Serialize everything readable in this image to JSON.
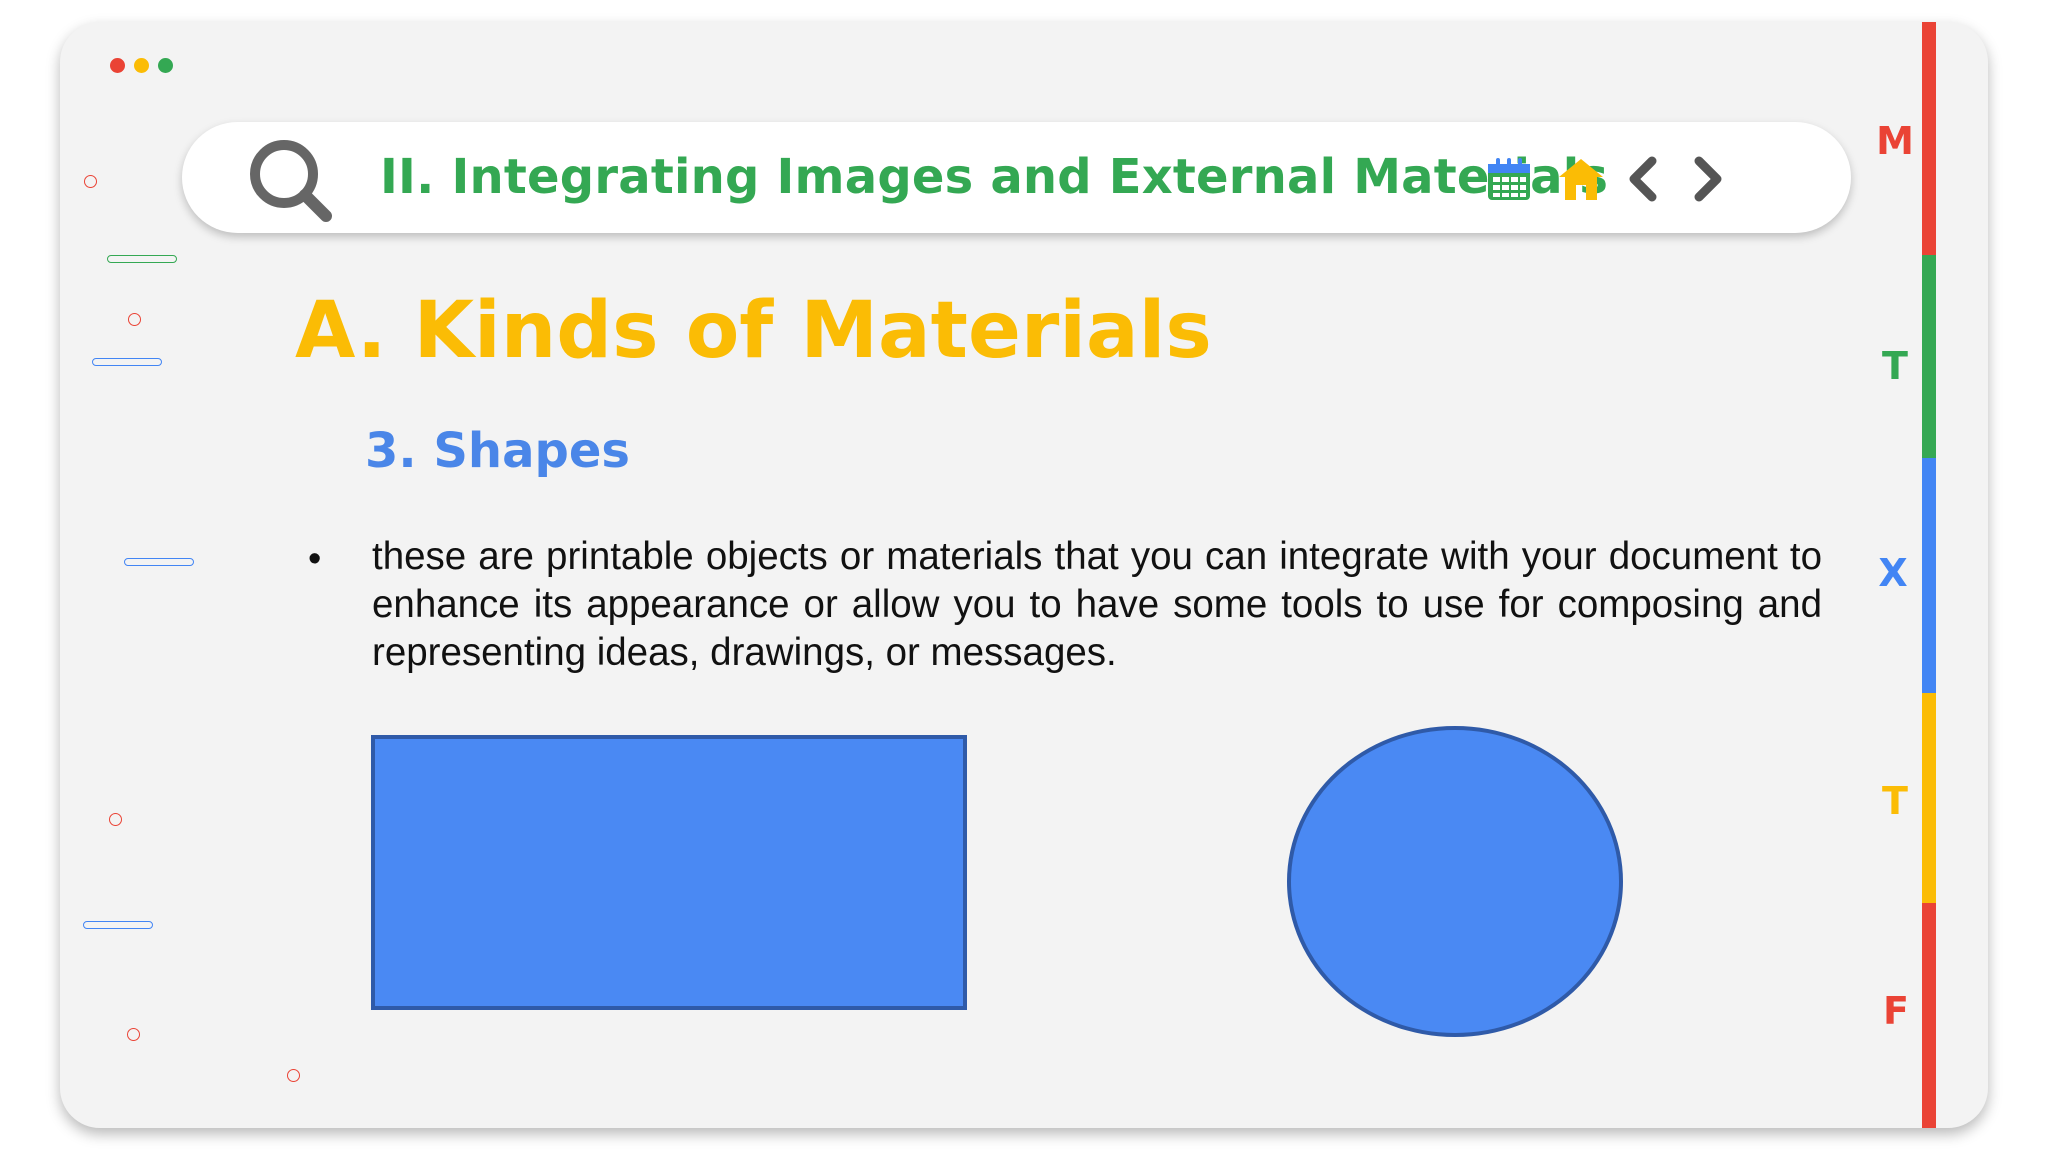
{
  "window": {
    "controls": [
      {
        "name": "close",
        "color": "#ea4335"
      },
      {
        "name": "minimize",
        "color": "#fbbc05"
      },
      {
        "name": "maximize",
        "color": "#34a853"
      }
    ]
  },
  "search_bar": {
    "title": "II. Integrating Images and External Materials",
    "title_color": "#34a853",
    "icons": [
      "search-icon",
      "calendar-icon",
      "home-icon",
      "chevron-left-icon",
      "chevron-right-icon"
    ]
  },
  "content": {
    "heading": "A. Kinds of Materials",
    "subheading": "3. Shapes",
    "bullet_symbol": "•",
    "body": "these are printable objects or materials that you can integrate with your document to enhance its appearance or allow you to have some tools to use for composing and representing ideas, drawings, or messages."
  },
  "shapes": [
    {
      "kind": "rectangle",
      "fill": "#4a89f3",
      "stroke": "#2f5aa8"
    },
    {
      "kind": "ellipse",
      "fill": "#4a89f3",
      "stroke": "#2f5aa8"
    }
  ],
  "side_tabs": [
    {
      "letter": "M",
      "color": "#ea4335"
    },
    {
      "letter": "T",
      "color": "#34a853"
    },
    {
      "letter": "X",
      "color": "#4285f4"
    },
    {
      "letter": "T",
      "color": "#fbbc05"
    },
    {
      "letter": "F",
      "color": "#ea4335"
    }
  ],
  "colors": {
    "heading": "#fbbc05",
    "subheading": "#4a86e8",
    "red": "#ea4335",
    "yellow": "#fbbc05",
    "green": "#34a853",
    "blue": "#4285f4"
  }
}
